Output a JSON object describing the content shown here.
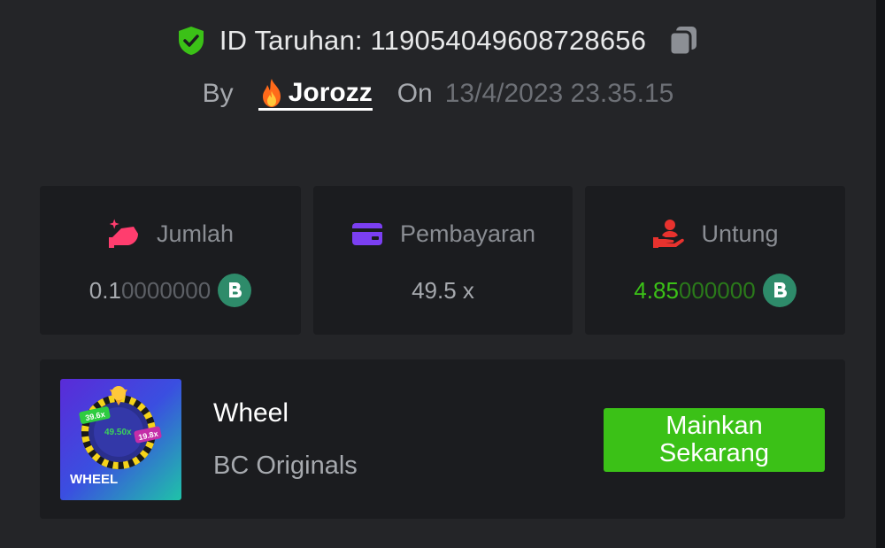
{
  "bet": {
    "id_label": "ID Taruhan: 1190540496087286 56",
    "id_text": "ID Taruhan: 119054049608728656",
    "by_label": "By",
    "username": "Jorozz",
    "on_label": "On",
    "date": "13/4/2023 23.35.15"
  },
  "stats": {
    "amount": {
      "label": "Jumlah",
      "value_bold": "0.1",
      "value_dim": "0000000"
    },
    "payout": {
      "label": "Pembayaran",
      "value": "49.5 x"
    },
    "profit": {
      "label": "Untung",
      "value_bold": "4.85",
      "value_dim": "000000"
    }
  },
  "game": {
    "name": "Wheel",
    "provider": "BC Originals",
    "play_button": [
      "Mainkan",
      "Sekarang"
    ],
    "thumb": {
      "title": "WHEEL",
      "multipliers": [
        "39.6x",
        "49.50x",
        "19.8x"
      ]
    }
  },
  "colors": {
    "background": "#242528",
    "card": "#1b1c1f",
    "accent_green": "#3bc117",
    "profit_green": "#3bc117",
    "coin": "#2e8b6a",
    "shield": "#3bc117"
  },
  "icons": {
    "verified": "shield-check-icon",
    "copy": "copy-icon",
    "user_badge": "fire-icon",
    "amount": "bet-amount-icon",
    "payout": "payment-card-icon",
    "profit": "profit-hand-icon",
    "currency": "bc-coin-icon"
  }
}
